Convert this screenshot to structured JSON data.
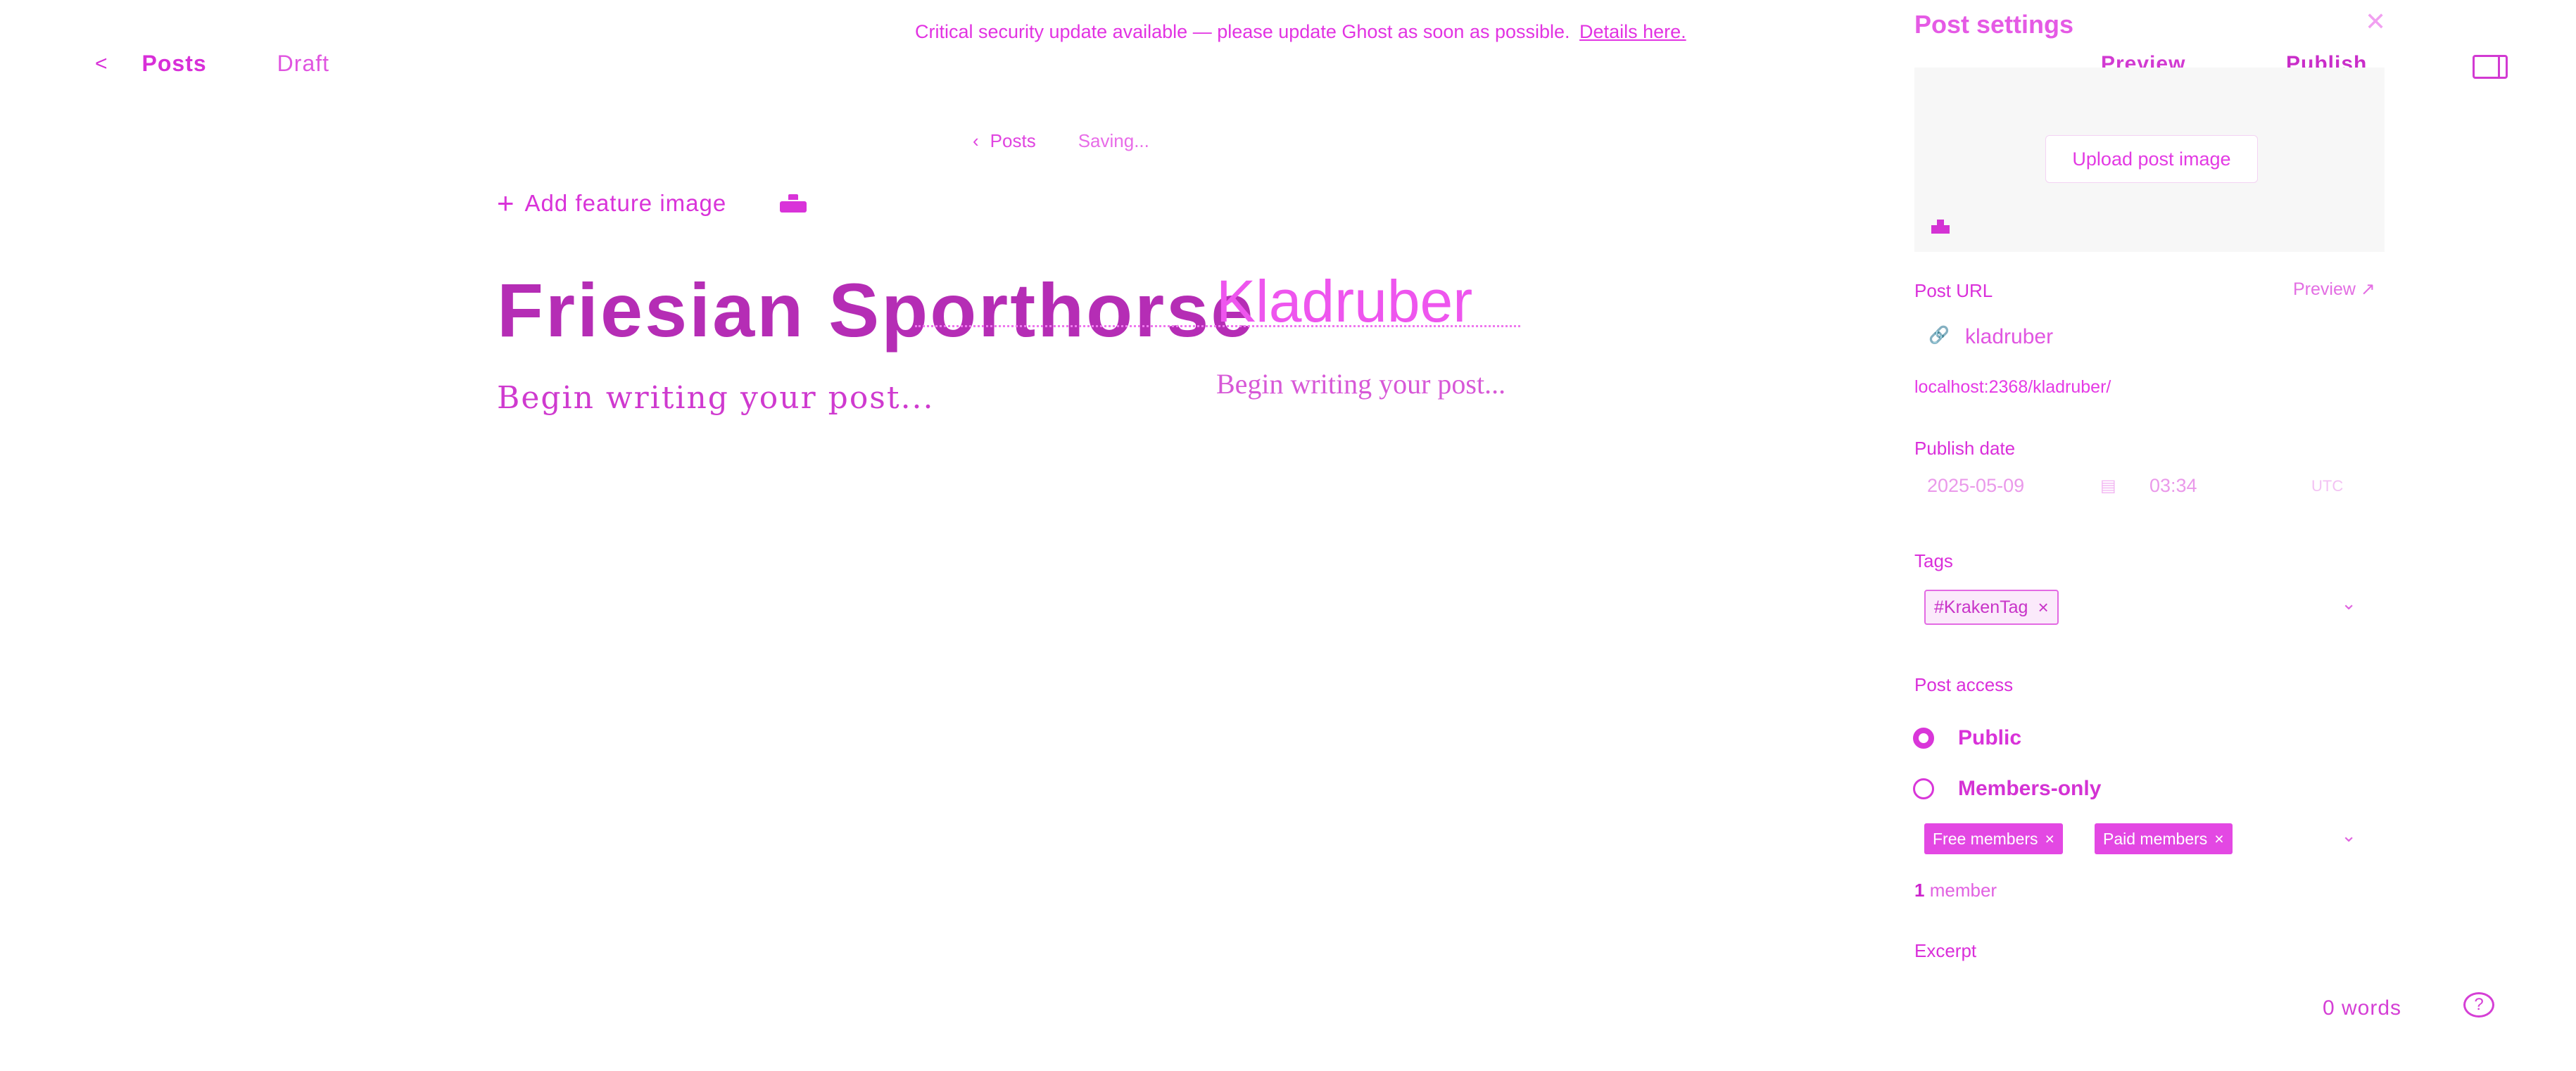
{
  "banner": {
    "text": "Critical security update available — please update Ghost as soon as possible.",
    "link": "Details here."
  },
  "nav": {
    "back_icon": "chevron-left-icon",
    "posts": "Posts",
    "status": "Draft"
  },
  "subnav": {
    "posts": "Posts",
    "status": "Saving..."
  },
  "editor": {
    "add_feature_image": "Add feature image",
    "title": "Friesian Sporthorse",
    "title_overlay": "Kladruber",
    "body_placeholder": "Begin writing your post...",
    "body_placeholder_overlay": "Begin writing your post...",
    "word_count": "0 words"
  },
  "header_actions": {
    "preview": "Preview",
    "publish": "Publish"
  },
  "settings": {
    "title": "Post settings",
    "upload_button": "Upload post image",
    "post_url_label": "Post URL",
    "post_url_preview": "Preview",
    "slug": "kladruber",
    "full_url": "localhost:2368/kladruber/",
    "publish_date_label": "Publish date",
    "date": "2025-05-09",
    "time": "03:34",
    "timezone": "UTC",
    "tags_label": "Tags",
    "tags": [
      "#KrakenTag"
    ],
    "post_access_label": "Post access",
    "access_options": [
      "Public",
      "Members-only"
    ],
    "selected_access": "Public",
    "segments": [
      "Free members",
      "Paid members"
    ],
    "member_count_number": "1",
    "member_count_text": "member",
    "excerpt_label": "Excerpt"
  },
  "colors": {
    "accent": "#e61ee6",
    "panel_image_bg": "#f7f7f7"
  }
}
